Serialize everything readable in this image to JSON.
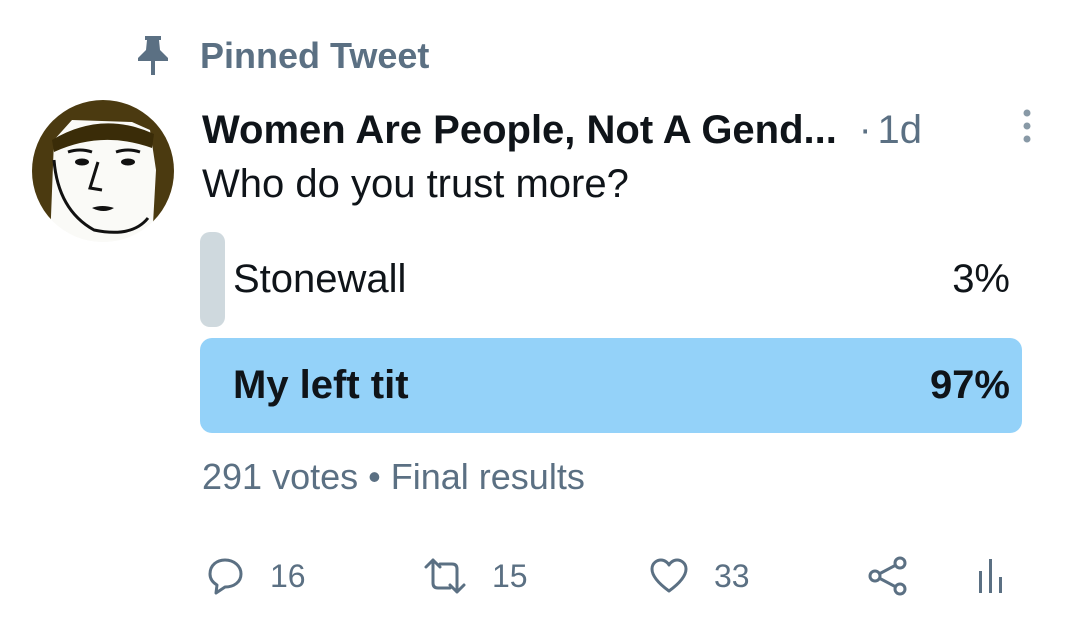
{
  "pinned": {
    "label": "Pinned Tweet",
    "icon": "pin-icon"
  },
  "tweet": {
    "author_name": "Women Are People, Not A Gend...",
    "separator": "·",
    "timestamp": "1d",
    "text": "Who do you trust more?"
  },
  "poll": {
    "options": [
      {
        "label": "Stonewall",
        "percent_text": "3%",
        "percent": 3
      },
      {
        "label": "My left tit",
        "percent_text": "97%",
        "percent": 97
      }
    ],
    "votes": "291 votes",
    "footer_separator": "•",
    "status": "Final results"
  },
  "actions": {
    "reply": {
      "icon": "reply-icon",
      "count": "16"
    },
    "retweet": {
      "icon": "retweet-icon",
      "count": "15"
    },
    "like": {
      "icon": "heart-icon",
      "count": "33"
    },
    "share": {
      "icon": "share-icon"
    },
    "analytics": {
      "icon": "analytics-icon"
    }
  },
  "colors": {
    "secondary_text": "#5b7083",
    "winning_bar": "#8ed0f9",
    "losing_bar": "#cfd9de"
  }
}
